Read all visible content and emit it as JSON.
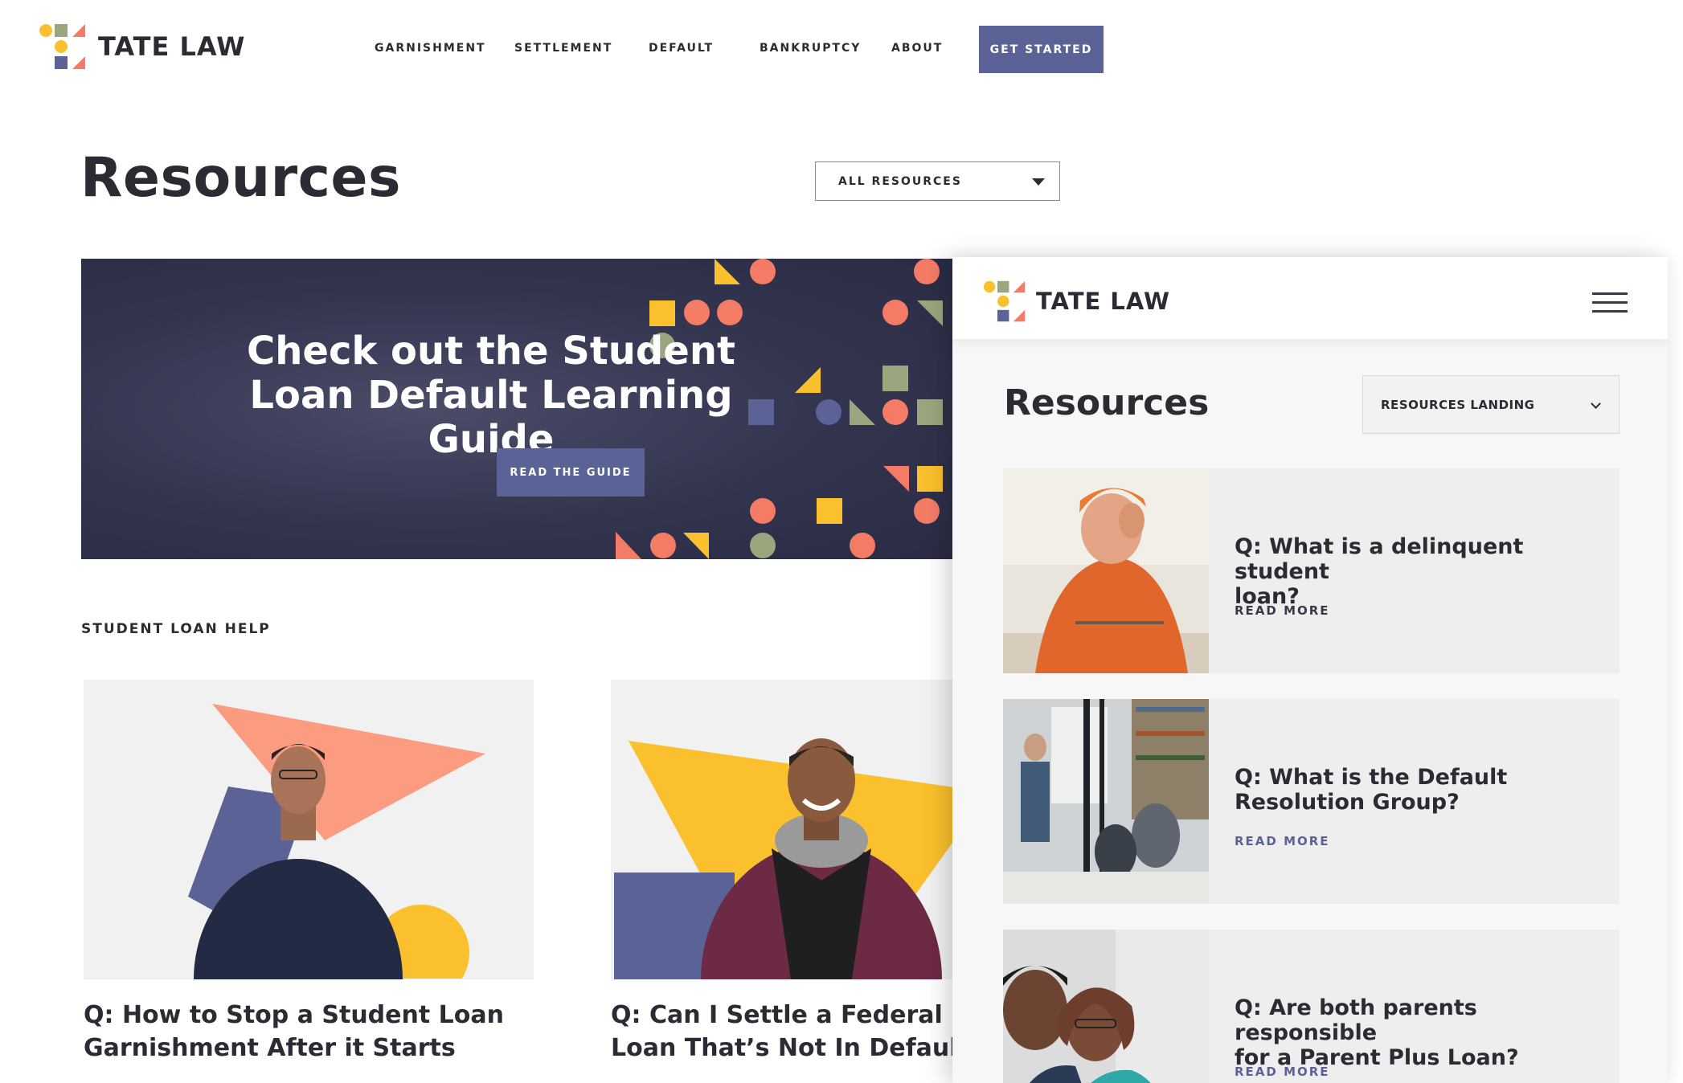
{
  "brand": {
    "name": "TATE LAW",
    "colors": {
      "navy": "#33354f",
      "accent": "#5b6396",
      "coral": "#f47c67",
      "yellow": "#fbc02d",
      "sage": "#9aa77e",
      "salmon": "#fb9b80"
    }
  },
  "nav": {
    "items": [
      {
        "label": "GARNISHMENT"
      },
      {
        "label": "SETTLEMENT"
      },
      {
        "label": "DEFAULT"
      },
      {
        "label": "BANKRUPTCY"
      },
      {
        "label": "ABOUT"
      }
    ],
    "cta": "GET STARTED"
  },
  "page": {
    "title": "Resources",
    "filter": {
      "value": "ALL RESOURCES",
      "icon": "caret-down-icon"
    }
  },
  "hero": {
    "title_line1": "Check out the Student",
    "title_line2": "Loan Default Learning Guide",
    "button": "READ THE GUIDE"
  },
  "section": {
    "label": "STUDENT LOAN HELP"
  },
  "cards": [
    {
      "title_line1": "Q: How to Stop a Student Loan",
      "title_line2": "Garnishment After it Starts"
    },
    {
      "title_line1": "Q: Can I Settle a Federal St",
      "title_line2": "Loan That’s Not In Default?"
    }
  ],
  "mobile": {
    "brand": "TATE LAW",
    "menu_icon": "hamburger-menu-icon",
    "title": "Resources",
    "filter": {
      "value": "RESOURCES LANDING",
      "icon": "chevron-down-icon"
    },
    "articles": [
      {
        "question_line1": "Q: What is a delinquent student",
        "question_line2": "loan?",
        "link": "READ MORE"
      },
      {
        "question_line1": "Q: What is the Default",
        "question_line2": "Resolution Group?",
        "link": "READ MORE"
      },
      {
        "question_line1": "Q: Are both parents responsible",
        "question_line2": "for a Parent Plus Loan?",
        "link": "READ MORE"
      }
    ]
  }
}
